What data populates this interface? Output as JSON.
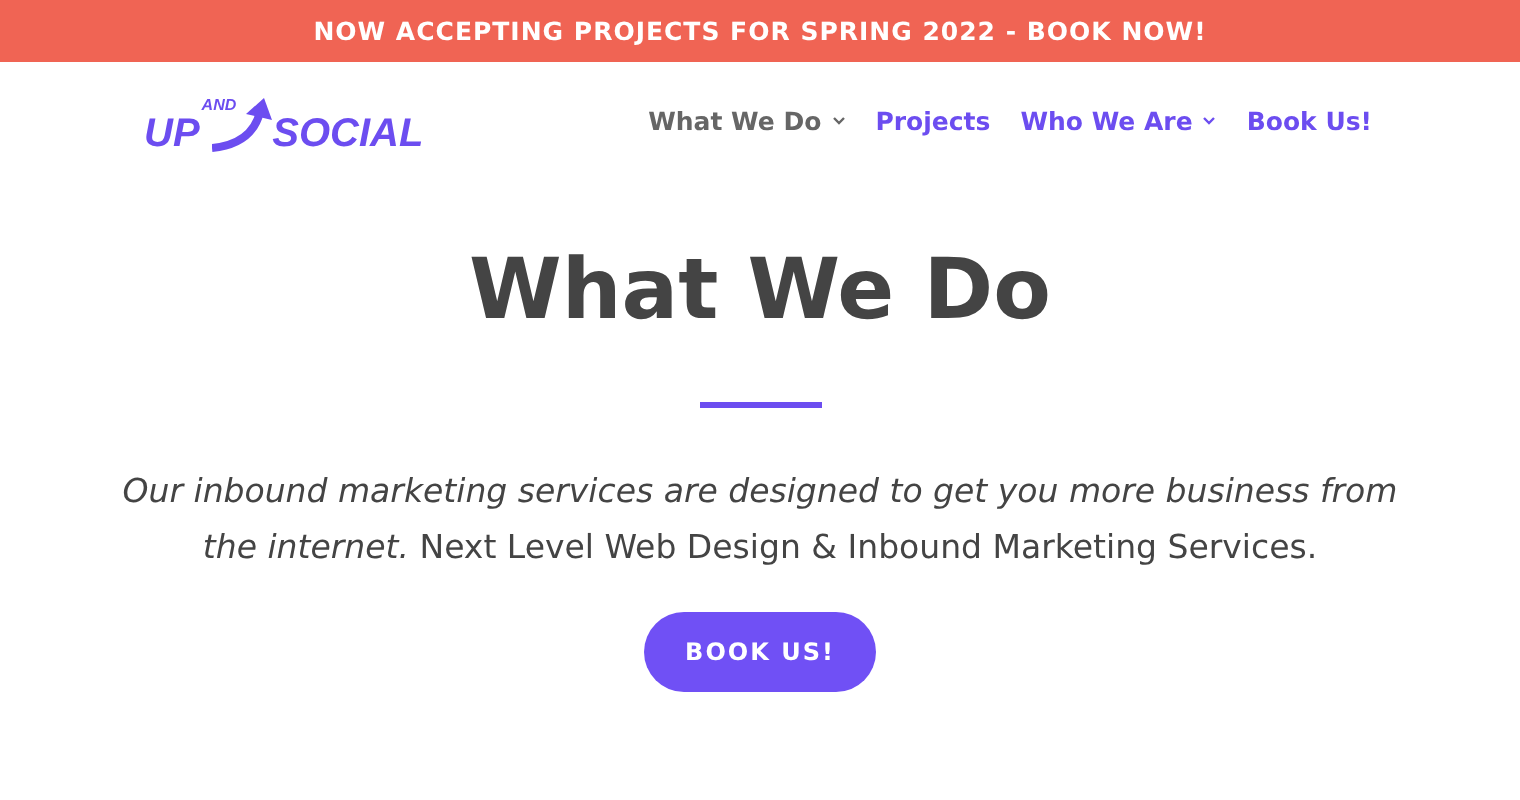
{
  "banner": {
    "text": "NOW ACCEPTING PROJECTS FOR SPRING 2022 - BOOK NOW!"
  },
  "logo": {
    "left": "UP",
    "small": "AND",
    "right": "SOCIAL"
  },
  "nav": [
    {
      "label": "What We Do",
      "selected": true,
      "dropdown": true
    },
    {
      "label": "Projects",
      "selected": false,
      "dropdown": false
    },
    {
      "label": "Who We Are",
      "selected": false,
      "dropdown": true
    },
    {
      "label": "Book Us!",
      "selected": false,
      "dropdown": false
    }
  ],
  "hero": {
    "title": "What We Do",
    "intro": "*Our inbound marketing services are designed to get you more business from the internet.* Next Level Web Design & Inbound Marketing Services.",
    "button": "BOOK US!"
  }
}
